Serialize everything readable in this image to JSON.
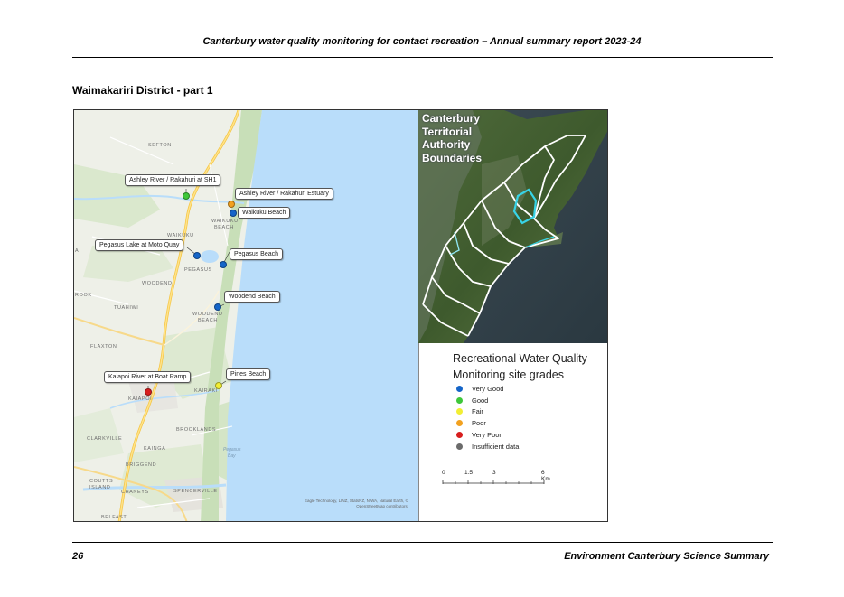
{
  "header": {
    "title": "Canterbury water quality monitoring for contact recreation – Annual summary report 2023-24"
  },
  "section": {
    "title": "Waimakariri District - part 1"
  },
  "map": {
    "place_names": {
      "sefton": "SEFTON",
      "waikuku": "WAIKUKU",
      "waikuku_beach_1": "WAIKUKU",
      "waikuku_beach_2": "BEACH",
      "pegasus": "PEGASUS",
      "woodend": "WOODEND",
      "woodend_beach_1": "WOODEND",
      "woodend_beach_2": "BEACH",
      "tuahiwi": "TUAHIWI",
      "flaxton": "FLAXTON",
      "kaiapoi": "KAIAPOI",
      "kairaki": "KAIRAKI",
      "brooklands": "BROOKLANDS",
      "clarkville": "CLARKVILLE",
      "kainga": "KAINGA",
      "briggend": "BRIGGEND",
      "coutts_island_1": "COUTTS",
      "coutts_island_2": "ISLAND",
      "chaneys": "CHANEYS",
      "spencerville": "SPENCERVILLE",
      "belfast": "BELFAST",
      "edge_a": "A",
      "edge_rook": "ROOK",
      "pegasus_bay_1": "Pegasus",
      "pegasus_bay_2": "Bay"
    },
    "sites": [
      {
        "label": "Ashley River / Rakahuri at SH1",
        "grade": "Good"
      },
      {
        "label": "Ashley River / Rakahuri Estuary",
        "grade": "Poor"
      },
      {
        "label": "Waikuku Beach",
        "grade": "Very Good"
      },
      {
        "label": "Pegasus Lake at Moto Quay",
        "grade": "Very Good"
      },
      {
        "label": "Pegasus Beach",
        "grade": "Very Good"
      },
      {
        "label": "Woodend Beach",
        "grade": "Very Good"
      },
      {
        "label": "Pines Beach",
        "grade": "Fair"
      },
      {
        "label": "Kaiapoi River at Boat Ramp",
        "grade": "Very Poor"
      }
    ],
    "attribution_1": "Eagle Technology, LINZ, StatsNZ, NIWA, Natural Earth, ©",
    "attribution_2": "OpenStreetMap contributors."
  },
  "inset": {
    "title_line1": "Canterbury",
    "title_line2": "Territorial",
    "title_line3": "Authority",
    "title_line4": "Boundaries"
  },
  "legend": {
    "title_line1": "Recreational Water Quality",
    "title_line2": "Monitoring site grades",
    "items": [
      {
        "label": "Very Good",
        "color": "#1565c8"
      },
      {
        "label": "Good",
        "color": "#3ec73a"
      },
      {
        "label": "Fair",
        "color": "#f2ee34"
      },
      {
        "label": "Poor",
        "color": "#f2a11f"
      },
      {
        "label": "Very Poor",
        "color": "#d71e1e"
      },
      {
        "label": "Insufficient data",
        "color": "#6b6b6b"
      }
    ],
    "scale": {
      "labels": [
        "0",
        "1.5",
        "3",
        "6 Km"
      ]
    }
  },
  "footer": {
    "page_number": "26",
    "org": "Environment Canterbury Science Summary"
  }
}
